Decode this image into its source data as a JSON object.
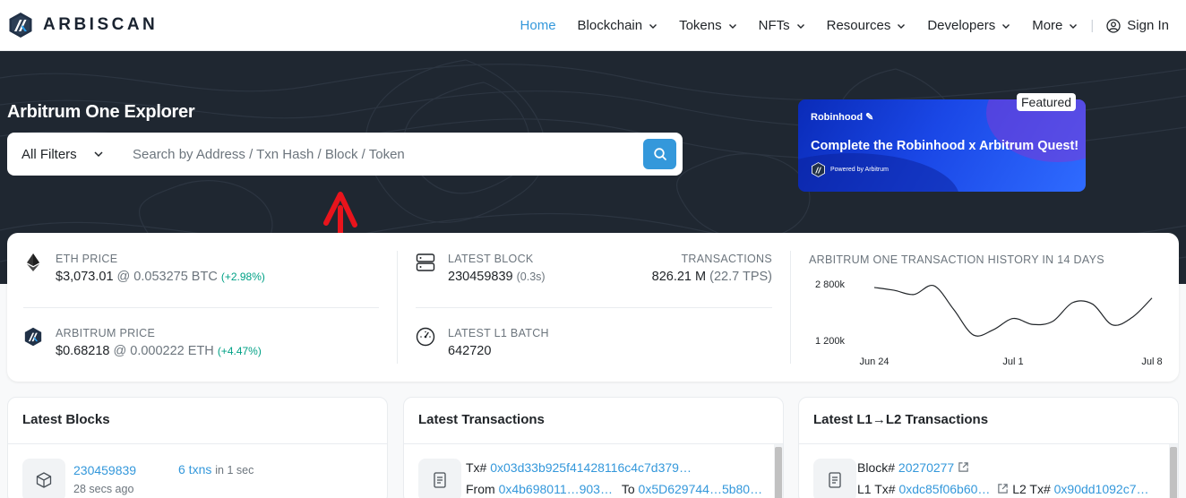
{
  "brand": {
    "name": "ARBISCAN"
  },
  "nav": {
    "home": "Home",
    "blockchain": "Blockchain",
    "tokens": "Tokens",
    "nfts": "NFTs",
    "resources": "Resources",
    "developers": "Developers",
    "more": "More",
    "separator": "|",
    "signin": "Sign In"
  },
  "hero": {
    "title": "Arbitrum One Explorer",
    "filter_label": "All Filters",
    "search_placeholder": "Search by Address / Txn Hash / Block / Token"
  },
  "ad": {
    "brand": "Robinhood",
    "headline": "Complete the Robinhood x Arbitrum Quest!",
    "powered_by": "Powered by Arbitrum",
    "featured_label": "Featured"
  },
  "stats": {
    "eth_price": {
      "label": "ETH PRICE",
      "value": "$3,073.01",
      "at": "@ 0.053275 BTC",
      "change": "(+2.98%)"
    },
    "arb_price": {
      "label": "ARBITRUM PRICE",
      "value": "$0.68218",
      "at": "@ 0.000222 ETH",
      "change": "(+4.47%)"
    },
    "latest_block": {
      "label": "LATEST BLOCK",
      "value": "230459839",
      "time": "(0.3s)"
    },
    "transactions": {
      "label": "TRANSACTIONS",
      "value": "826.21 M",
      "tps": "(22.7 TPS)"
    },
    "latest_l1_batch": {
      "label": "LATEST L1 BATCH",
      "value": "642720"
    }
  },
  "chart_data": {
    "type": "line",
    "title": "ARBITRUM ONE TRANSACTION HISTORY IN 14 DAYS",
    "y_tick_labels": [
      "2 800k",
      "1 200k"
    ],
    "x_tick_labels": [
      "Jun 24",
      "Jul 1",
      "Jul 8"
    ],
    "x": [
      "Jun 24",
      "Jun 25",
      "Jun 26",
      "Jun 27",
      "Jun 28",
      "Jun 29",
      "Jun 30",
      "Jul 1",
      "Jul 2",
      "Jul 3",
      "Jul 4",
      "Jul 5",
      "Jul 6",
      "Jul 7",
      "Jul 8"
    ],
    "values": [
      2700000,
      2620000,
      2500000,
      2750000,
      2080000,
      1350000,
      1500000,
      1820000,
      1650000,
      1740000,
      2270000,
      2230000,
      1640000,
      1850000,
      2400000
    ],
    "ylim": [
      1200000,
      2800000
    ],
    "grid": false,
    "color": "#212529"
  },
  "panels": {
    "blocks": {
      "title": "Latest Blocks",
      "row": {
        "block": "230459839",
        "age": "28 secs ago",
        "txns": "6 txns",
        "in_time": "in 1 sec"
      }
    },
    "transactions": {
      "title": "Latest Transactions",
      "row": {
        "tx_label": "Tx#",
        "hash": "0x03d33b925f41428116c4c7d379…",
        "from_label": "From",
        "from": "0x4b698011…903…",
        "to_label": "To",
        "to": "0x5D629744…5b80…"
      }
    },
    "l1l2": {
      "title": "Latest L1→L2 Transactions",
      "row": {
        "block_label": "Block#",
        "block": "20270277",
        "l1_label": "L1 Tx#",
        "l1": "0xdc85f06b60…",
        "l2_label": "L2 Tx#",
        "l2": "0x90dd1092c7…"
      }
    }
  },
  "colors": {
    "accent": "#3498db",
    "hero_bg": "#1f2731",
    "positive": "#00a186",
    "annotation_arrow": "#e8141c"
  }
}
